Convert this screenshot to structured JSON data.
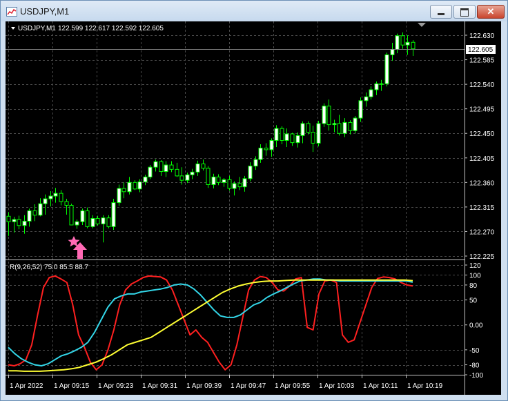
{
  "window": {
    "title": "USDJPY,M1",
    "minimize_icon": "minimize-icon",
    "maximize_icon": "maximize-icon",
    "close_glyph": "✕"
  },
  "price_chart": {
    "symbol_label": "USDJPY,M1",
    "ohlc_values": "122.599 122.617 122.592 122.605",
    "current_price": "122.605",
    "y_ticks": [
      "122.630",
      "122.585",
      "122.540",
      "122.495",
      "122.450",
      "122.405",
      "122.360",
      "122.315",
      "122.270",
      "122.225"
    ]
  },
  "indicator": {
    "label": "R(9,26,52) 75.0 85.5 88.7",
    "y_ticks": [
      "120",
      "100",
      "80",
      "50",
      "0.00",
      "-50",
      "-80",
      "-100"
    ]
  },
  "x_ticks": [
    "1 Apr 2022",
    "1 Apr 09:15",
    "1 Apr 09:23",
    "1 Apr 09:31",
    "1 Apr 09:39",
    "1 Apr 09:47",
    "1 Apr 09:55",
    "1 Apr 10:03",
    "1 Apr 10:11",
    "1 Apr 10:19"
  ],
  "colors": {
    "background": "#000000",
    "grid": "#4a4a4a",
    "candle": "#00ff00",
    "bull_body": "#ffffff",
    "bear_body": "#000000",
    "line_red": "#ff2020",
    "line_cyan": "#33d6e8",
    "line_yellow": "#ffff33",
    "marker": "#ff69b4"
  },
  "markers": {
    "star_icon": "star-icon",
    "arrow_icon": "up-arrow-icon"
  },
  "chart_data": [
    {
      "type": "candlestick",
      "title": "USDJPY,M1",
      "ylim": [
        122.225,
        122.63
      ],
      "x": [
        "1 Apr 2022",
        "1 Apr 09:15",
        "1 Apr 09:23",
        "1 Apr 09:31",
        "1 Apr 09:39",
        "1 Apr 09:47",
        "1 Apr 09:55",
        "1 Apr 10:03",
        "1 Apr 10:11",
        "1 Apr 10:19"
      ],
      "series": [
        {
          "values": [
            [
              122.298,
              122.305,
              122.262,
              122.288
            ],
            [
              122.288,
              122.297,
              122.268,
              122.292
            ],
            [
              122.292,
              122.299,
              122.274,
              122.281
            ],
            [
              122.281,
              122.3,
              122.266,
              122.289
            ],
            [
              122.289,
              122.312,
              122.279,
              122.308
            ],
            [
              122.308,
              122.32,
              122.289,
              122.3
            ],
            [
              122.3,
              122.331,
              122.298,
              122.321
            ],
            [
              122.321,
              122.338,
              122.301,
              122.33
            ],
            [
              122.33,
              122.344,
              122.316,
              122.335
            ],
            [
              122.335,
              122.35,
              122.323,
              122.34
            ],
            [
              122.34,
              122.346,
              122.318,
              122.325
            ],
            [
              122.325,
              122.33,
              122.301,
              122.318
            ],
            [
              122.318,
              122.321,
              122.287,
              122.282
            ],
            [
              122.282,
              122.292,
              122.275,
              122.288
            ],
            [
              122.288,
              122.312,
              122.282,
              122.308
            ],
            [
              122.308,
              122.314,
              122.276,
              122.279
            ],
            [
              122.279,
              122.3,
              122.276,
              122.294
            ],
            [
              122.294,
              122.299,
              122.281,
              122.284
            ],
            [
              122.284,
              122.3,
              122.25,
              122.295
            ],
            [
              122.295,
              122.3,
              122.276,
              122.279
            ],
            [
              122.279,
              122.33,
              122.273,
              122.323
            ],
            [
              122.323,
              122.356,
              122.317,
              122.349
            ],
            [
              122.349,
              122.36,
              122.331,
              122.343
            ],
            [
              122.343,
              122.37,
              122.338,
              122.36
            ],
            [
              122.36,
              122.364,
              122.346,
              122.348
            ],
            [
              122.348,
              122.366,
              122.342,
              122.361
            ],
            [
              122.361,
              122.374,
              122.355,
              122.37
            ],
            [
              122.37,
              122.392,
              122.366,
              122.388
            ],
            [
              122.388,
              122.402,
              122.38,
              122.398
            ],
            [
              122.398,
              122.401,
              122.372,
              122.38
            ],
            [
              122.38,
              122.399,
              122.37,
              122.392
            ],
            [
              122.392,
              122.399,
              122.379,
              122.384
            ],
            [
              122.384,
              122.396,
              122.37,
              122.372
            ],
            [
              122.372,
              122.388,
              122.356,
              122.364
            ],
            [
              122.364,
              122.378,
              122.359,
              122.374
            ],
            [
              122.374,
              122.385,
              122.366,
              122.379
            ],
            [
              122.379,
              122.4,
              122.372,
              122.394
            ],
            [
              122.394,
              122.402,
              122.382,
              122.386
            ],
            [
              122.386,
              122.39,
              122.35,
              122.356
            ],
            [
              122.356,
              122.376,
              122.349,
              122.37
            ],
            [
              122.37,
              122.375,
              122.355,
              122.36
            ],
            [
              122.36,
              122.368,
              122.352,
              122.365
            ],
            [
              122.365,
              122.372,
              122.345,
              122.349
            ],
            [
              122.349,
              122.362,
              122.336,
              122.358
            ],
            [
              122.358,
              122.37,
              122.346,
              122.352
            ],
            [
              122.352,
              122.372,
              122.343,
              122.367
            ],
            [
              122.367,
              122.397,
              122.362,
              122.39
            ],
            [
              122.39,
              122.408,
              122.383,
              122.402
            ],
            [
              122.402,
              122.43,
              122.396,
              122.423
            ],
            [
              122.423,
              122.432,
              122.409,
              122.42
            ],
            [
              122.42,
              122.441,
              122.407,
              122.437
            ],
            [
              122.437,
              122.465,
              122.425,
              122.459
            ],
            [
              122.459,
              122.463,
              122.43,
              122.437
            ],
            [
              122.437,
              122.459,
              122.425,
              122.449
            ],
            [
              122.449,
              122.451,
              122.427,
              122.433
            ],
            [
              122.433,
              122.452,
              122.424,
              122.446
            ],
            [
              122.446,
              122.472,
              122.432,
              122.468
            ],
            [
              122.468,
              122.472,
              122.448,
              122.452
            ],
            [
              122.452,
              122.464,
              122.416,
              122.432
            ],
            [
              122.432,
              122.473,
              122.426,
              122.468
            ],
            [
              122.468,
              122.505,
              122.462,
              122.5
            ],
            [
              122.5,
              122.512,
              122.455,
              122.466
            ],
            [
              122.466,
              122.475,
              122.452,
              122.468
            ],
            [
              122.468,
              122.484,
              122.446,
              122.45
            ],
            [
              122.45,
              122.478,
              122.443,
              122.47
            ],
            [
              122.47,
              122.474,
              122.448,
              122.455
            ],
            [
              122.455,
              122.482,
              122.45,
              122.478
            ],
            [
              122.478,
              122.516,
              122.471,
              122.51
            ],
            [
              122.51,
              122.525,
              122.499,
              122.517
            ],
            [
              122.517,
              122.536,
              122.512,
              122.53
            ],
            [
              122.53,
              122.545,
              122.52,
              122.541
            ],
            [
              122.541,
              122.548,
              122.528,
              122.541
            ],
            [
              122.541,
              122.598,
              122.536,
              122.594
            ],
            [
              122.594,
              122.616,
              122.583,
              122.604
            ],
            [
              122.604,
              122.633,
              122.597,
              122.629
            ],
            [
              122.629,
              122.635,
              122.605,
              122.612
            ],
            [
              122.612,
              122.63,
              122.594,
              122.617
            ],
            [
              122.617,
              122.621,
              122.592,
              122.605
            ]
          ]
        }
      ]
    },
    {
      "type": "line",
      "title": "R(9,26,52) 75.0 85.5 88.7",
      "ylim": [
        -100,
        120
      ],
      "x": [
        "1 Apr 2022",
        "1 Apr 09:15",
        "1 Apr 09:23",
        "1 Apr 09:31",
        "1 Apr 09:39",
        "1 Apr 09:47",
        "1 Apr 09:55",
        "1 Apr 10:03",
        "1 Apr 10:11",
        "1 Apr 10:19"
      ],
      "series": [
        {
          "color": "#ff2020",
          "values": [
            -80,
            -82,
            -78,
            -70,
            -40,
            20,
            75,
            95,
            98,
            92,
            85,
            40,
            -20,
            -45,
            -75,
            -90,
            -80,
            -50,
            -10,
            40,
            70,
            82,
            88,
            95,
            98,
            97,
            96,
            90,
            70,
            40,
            10,
            -20,
            -10,
            -25,
            -35,
            -55,
            -75,
            -90,
            -80,
            -40,
            15,
            70,
            90,
            97,
            95,
            85,
            70,
            68,
            78,
            92,
            95,
            -5,
            -10,
            62,
            88,
            90,
            85,
            -20,
            -35,
            -30,
            5,
            40,
            75,
            93,
            96,
            95,
            92,
            85,
            80,
            78
          ]
        },
        {
          "color": "#33d6e8",
          "values": [
            -45,
            -58,
            -68,
            -75,
            -80,
            -82,
            -78,
            -70,
            -62,
            -58,
            -52,
            -45,
            -35,
            -15,
            10,
            35,
            52,
            58,
            62,
            62,
            66,
            68,
            70,
            72,
            75,
            80,
            82,
            80,
            72,
            60,
            45,
            30,
            18,
            15,
            15,
            20,
            30,
            40,
            45,
            55,
            62,
            68,
            75,
            82,
            88,
            90,
            92,
            92,
            90,
            90,
            88,
            88,
            88,
            88,
            88,
            88,
            88,
            88,
            88,
            88,
            88,
            85.5
          ]
        },
        {
          "color": "#ffff33",
          "values": [
            -92,
            -92,
            -93,
            -93,
            -93,
            -92,
            -91,
            -90,
            -88,
            -85,
            -80,
            -75,
            -68,
            -60,
            -50,
            -40,
            -35,
            -30,
            -25,
            -15,
            -5,
            5,
            15,
            25,
            35,
            45,
            55,
            65,
            72,
            78,
            82,
            85,
            87,
            88,
            88,
            89,
            90,
            90,
            90,
            90,
            90,
            90,
            90,
            90,
            90,
            90,
            90,
            90,
            90,
            90,
            90,
            88.7
          ]
        }
      ]
    }
  ]
}
